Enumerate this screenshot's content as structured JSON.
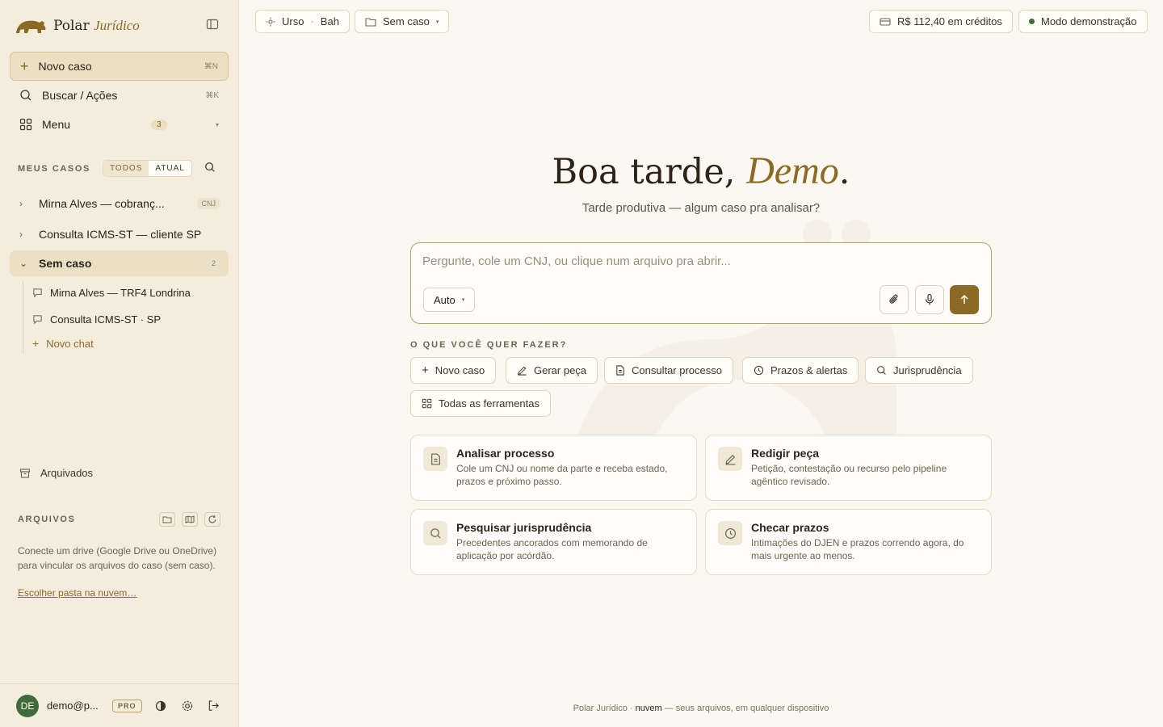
{
  "brand": {
    "name": "Polar",
    "name_italic": "Jurídico"
  },
  "sidebar": {
    "nav": [
      {
        "label": "Novo caso",
        "kbd": "⌘N"
      },
      {
        "label": "Buscar / Ações",
        "kbd": "⌘K"
      },
      {
        "label": "Menu",
        "badge": "3"
      }
    ],
    "cases_title": "MEUS CASOS",
    "filter_all": "TODOS",
    "filter_current": "ATUAL",
    "cases": [
      {
        "label": "Mirna Alves — cobranç...",
        "tag": "CNJ"
      },
      {
        "label": "Consulta ICMS-ST — cliente SP"
      },
      {
        "label": "Sem caso",
        "tag": "2"
      }
    ],
    "chats": [
      "Mirna Alves — TRF4 Londrina",
      "Consulta ICMS-ST · SP"
    ],
    "new_chat": "Novo chat",
    "archived": "Arquivados",
    "files_title": "ARQUIVOS",
    "files_desc": "Conecte um drive (Google Drive ou OneDrive) para vincular os arquivos do caso (sem caso).",
    "files_link": "Escolher pasta na nuvem…",
    "user": {
      "initials": "DE",
      "email": "demo@p...",
      "plan": "PRO"
    }
  },
  "topbar": {
    "context_a": "Urso",
    "context_b": "Bah",
    "case_select": "Sem caso",
    "credits": "R$ 112,40 em créditos",
    "mode": "Modo demonstração"
  },
  "main": {
    "greeting": "Boa tarde,",
    "greeting_name": "Demo",
    "greeting_end": ".",
    "subtitle": "Tarde produtiva — algum caso pra analisar?",
    "composer_placeholder": "Pergunte, cole um CNJ, ou clique num arquivo pra abrir...",
    "model_select": "Auto",
    "quick_title": "O QUE VOCÊ QUER FAZER?",
    "quick": [
      "Novo caso",
      "Gerar peça",
      "Consultar processo",
      "Prazos & alertas",
      "Jurisprudência",
      "Todas as ferramentas"
    ],
    "cards": [
      {
        "title": "Analisar processo",
        "desc": "Cole um CNJ ou nome da parte e receba estado, prazos e próximo passo.",
        "icon": "document-icon"
      },
      {
        "title": "Redigir peça",
        "desc": "Petição, contestação ou recurso pelo pipeline agêntico revisado.",
        "icon": "pen-icon"
      },
      {
        "title": "Pesquisar jurisprudência",
        "desc": "Precedentes ancorados com memorando de aplicação por acórdão.",
        "icon": "search-icon"
      },
      {
        "title": "Checar prazos",
        "desc": "Intimações do DJEN e prazos correndo agora, do mais urgente ao menos.",
        "icon": "clock-icon"
      }
    ]
  },
  "footer": {
    "pre": "Polar Jurídico · ",
    "bold": "nuvem",
    "post": " — seus arquivos, em qualquer dispositivo"
  },
  "colors": {
    "accent": "#8a6a25",
    "sidebar_bg": "#f4ecdc",
    "page_bg": "#fbf8f1",
    "status_green": "#3f6b3a"
  }
}
